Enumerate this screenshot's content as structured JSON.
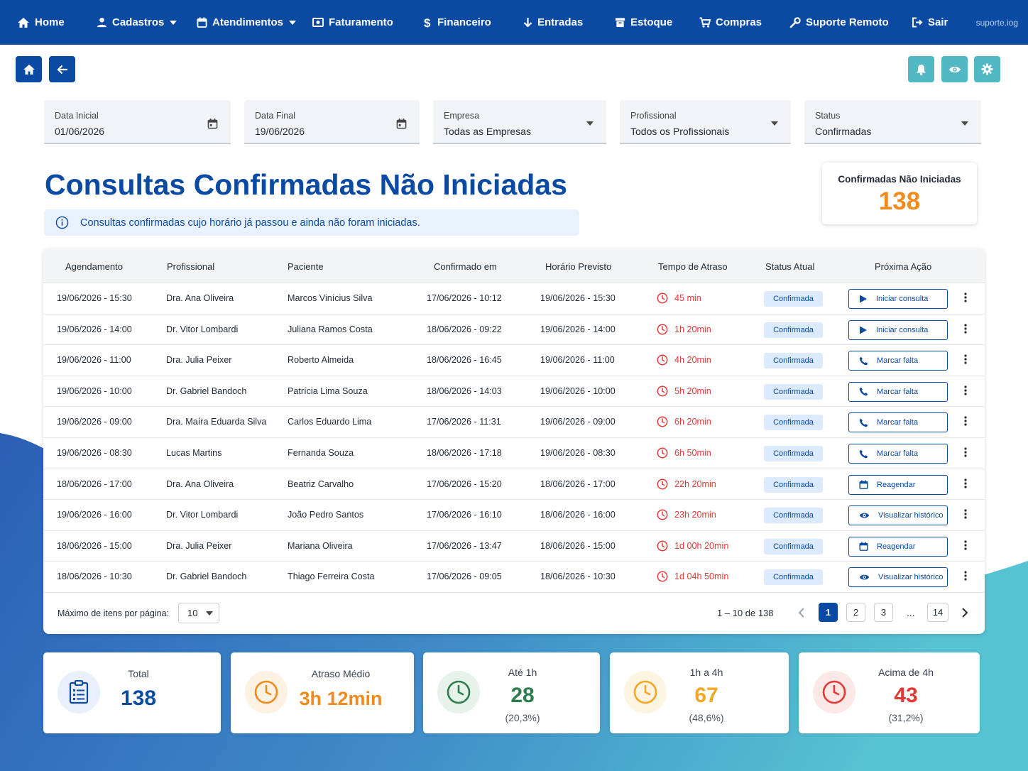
{
  "colors": {
    "primary": "#0b4aa2",
    "teal": "#52b8c4",
    "orange": "#f28a1c",
    "green": "#2e7d4f",
    "yellow": "#f5a623",
    "red": "#e53935"
  },
  "nav": {
    "items": [
      {
        "label": "Home",
        "icon": "home-icon"
      },
      {
        "label": "Cadastros",
        "icon": "user-icon",
        "dropdown": true
      },
      {
        "label": "Atendimentos",
        "icon": "calendar-icon",
        "dropdown": true
      },
      {
        "label": "Faturamento",
        "icon": "money-icon"
      },
      {
        "label": "Financeiro",
        "icon": "dollar-icon"
      },
      {
        "label": "Entradas",
        "icon": "arrow-down-icon"
      },
      {
        "label": "Estoque",
        "icon": "box-icon"
      },
      {
        "label": "Compras",
        "icon": "cart-icon"
      },
      {
        "label": "Suporte Remoto",
        "icon": "wrench-icon"
      },
      {
        "label": "Sair",
        "icon": "logout-icon"
      }
    ],
    "brand": "suporte.iog"
  },
  "filters": [
    {
      "label": "Data Inicial",
      "value": "01/06/2026",
      "icon": "calendar-icon"
    },
    {
      "label": "Data Final",
      "value": "19/06/2026",
      "icon": "calendar-icon"
    },
    {
      "label": "Empresa",
      "value": "Todas as Empresas",
      "icon": "chevron-down-icon"
    },
    {
      "label": "Profissional",
      "value": "Todos os Profissionais",
      "icon": "chevron-down-icon"
    },
    {
      "label": "Status",
      "value": "Confirmadas",
      "icon": "chevron-down-icon"
    }
  ],
  "page": {
    "title": "Consultas Confirmadas Não Iniciadas",
    "info": "Consultas confirmadas cujo horário já passou e ainda não foram iniciadas."
  },
  "kpi": {
    "label": "Confirmadas Não Iniciadas",
    "value": "138"
  },
  "table": {
    "headers": [
      "Agendamento",
      "Profissional",
      "Paciente",
      "Confirmado em",
      "Horário Previsto",
      "Tempo de Atraso",
      "Status Atual",
      "Próxima Ação"
    ],
    "rows": [
      {
        "agendamento": "19/06/2026 - 15:30",
        "profissional": "Dra. Ana Oliveira",
        "paciente": "Marcos Vinícius Silva",
        "confirmado": "17/06/2026 - 10:12",
        "previsto": "19/06/2026 - 15:30",
        "atraso": "45 min",
        "status": "Confirmada",
        "acao": "Iniciar consulta",
        "acao_icon": "play-icon"
      },
      {
        "agendamento": "19/06/2026 - 14:00",
        "profissional": "Dr. Vitor Lombardi",
        "paciente": "Juliana Ramos Costa",
        "confirmado": "18/06/2026 - 09:22",
        "previsto": "19/06/2026 - 14:00",
        "atraso": "1h 20min",
        "status": "Confirmada",
        "acao": "Iniciar consulta",
        "acao_icon": "play-icon"
      },
      {
        "agendamento": "19/06/2026 - 11:00",
        "profissional": "Dra. Julia Peixer",
        "paciente": "Roberto Almeida",
        "confirmado": "18/06/2026 - 16:45",
        "previsto": "19/06/2026 - 11:00",
        "atraso": "4h 20min",
        "status": "Confirmada",
        "acao": "Marcar falta",
        "acao_icon": "phone-icon"
      },
      {
        "agendamento": "19/06/2026 - 10:00",
        "profissional": "Dr. Gabriel Bandoch",
        "paciente": "Patrícia Lima Souza",
        "confirmado": "18/06/2026 - 14:03",
        "previsto": "19/06/2026 - 10:00",
        "atraso": "5h 20min",
        "status": "Confirmada",
        "acao": "Marcar falta",
        "acao_icon": "phone-icon"
      },
      {
        "agendamento": "19/06/2026 - 09:00",
        "profissional": "Dra. Maíra Eduarda Silva",
        "paciente": "Carlos Eduardo Lima",
        "confirmado": "17/06/2026 - 11:31",
        "previsto": "19/06/2026 - 09:00",
        "atraso": "6h 20min",
        "status": "Confirmada",
        "acao": "Marcar falta",
        "acao_icon": "phone-icon"
      },
      {
        "agendamento": "19/06/2026 - 08:30",
        "profissional": "Lucas Martins",
        "paciente": "Fernanda Souza",
        "confirmado": "18/06/2026 - 17:18",
        "previsto": "19/06/2026 - 08:30",
        "atraso": "6h 50min",
        "status": "Confirmada",
        "acao": "Marcar falta",
        "acao_icon": "phone-icon"
      },
      {
        "agendamento": "18/06/2026 - 17:00",
        "profissional": "Dra. Ana Oliveira",
        "paciente": "Beatriz Carvalho",
        "confirmado": "17/06/2026 - 15:20",
        "previsto": "18/06/2026 - 17:00",
        "atraso": "22h 20min",
        "status": "Confirmada",
        "acao": "Reagendar",
        "acao_icon": "calendar-icon"
      },
      {
        "agendamento": "19/06/2026 - 16:00",
        "profissional": "Dr. Vitor Lombardi",
        "paciente": "João Pedro Santos",
        "confirmado": "17/06/2026 - 16:10",
        "previsto": "18/06/2026 - 16:00",
        "atraso": "23h 20min",
        "status": "Confirmada",
        "acao": "Visualizar histórico",
        "acao_icon": "eye-icon"
      },
      {
        "agendamento": "18/06/2026 - 15:00",
        "profissional": "Dra. Julia Peixer",
        "paciente": "Mariana Oliveira",
        "confirmado": "17/06/2026 - 13:47",
        "previsto": "18/06/2026 - 15:00",
        "atraso": "1d 00h 20min",
        "status": "Confirmada",
        "acao": "Reagendar",
        "acao_icon": "calendar-icon"
      },
      {
        "agendamento": "18/06/2026 - 10:30",
        "profissional": "Dr. Gabriel Bandoch",
        "paciente": "Thiago Ferreira Costa",
        "confirmado": "17/06/2026 - 09:05",
        "previsto": "18/06/2026 - 10:30",
        "atraso": "1d 04h 50min",
        "status": "Confirmada",
        "acao": "Visualizar histórico",
        "acao_icon": "eye-icon"
      }
    ]
  },
  "pagination": {
    "per_page_label": "Máximo de itens por página:",
    "per_page_value": "10",
    "range": "1 – 10 de 138",
    "pages": [
      "1",
      "2",
      "3"
    ],
    "ellipsis": "...",
    "last_page": "14",
    "current_page": "1"
  },
  "stats": [
    {
      "label": "Total",
      "value": "138",
      "pct": "",
      "icon": "clipboard-icon",
      "color": "#0b4aa2"
    },
    {
      "label": "Atraso Médio",
      "value": "3h 12min",
      "pct": "",
      "icon": "clock-icon",
      "color": "#f28a1c"
    },
    {
      "label": "Até 1h",
      "value": "28",
      "pct": "(20,3%)",
      "icon": "clock-icon",
      "color": "#2e7d4f"
    },
    {
      "label": "1h a 4h",
      "value": "67",
      "pct": "(48,6%)",
      "icon": "clock-icon",
      "color": "#f5a623"
    },
    {
      "label": "Acima de 4h",
      "value": "43",
      "pct": "(31,2%)",
      "icon": "clock-icon",
      "color": "#e53935"
    }
  ]
}
